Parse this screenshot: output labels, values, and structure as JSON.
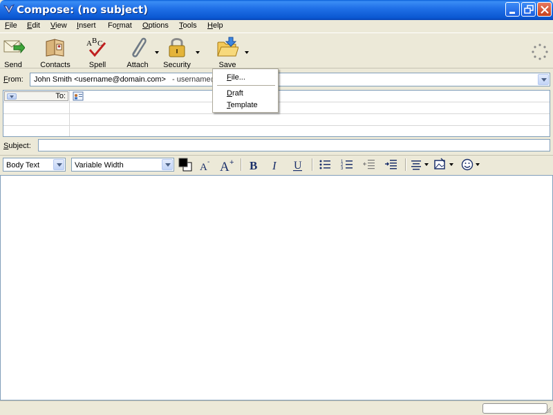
{
  "window": {
    "title": "Compose: (no subject)"
  },
  "menu": [
    {
      "acc": "F",
      "rest": "ile"
    },
    {
      "acc": "E",
      "rest": "dit"
    },
    {
      "acc": "V",
      "rest": "iew"
    },
    {
      "acc": "I",
      "rest": "nsert"
    },
    {
      "pre": "Fo",
      "acc": "r",
      "rest": "mat"
    },
    {
      "acc": "O",
      "rest": "ptions"
    },
    {
      "acc": "T",
      "rest": "ools"
    },
    {
      "acc": "H",
      "rest": "elp"
    }
  ],
  "toolbar": {
    "send": "Send",
    "contacts": "Contacts",
    "spell": "Spell",
    "attach": "Attach",
    "security": "Security",
    "save": "Save"
  },
  "address": {
    "from_label": "From:",
    "from_value": "John Smith <username@domain.com>",
    "from_account": "- username@",
    "to_label": "To:",
    "subject_label": "Subject:",
    "subject_value": ""
  },
  "format": {
    "paragraph": "Body Text",
    "font": "Variable Width",
    "text_color": "#000000"
  },
  "save_menu": {
    "file": {
      "acc": "F",
      "rest": "ile..."
    },
    "draft": {
      "acc": "D",
      "rest": "raft"
    },
    "template": {
      "acc": "T",
      "rest": "emplate"
    }
  },
  "colors": {
    "titlebar": "#0b58d2",
    "chrome": "#ece9d8",
    "field_border": "#7f9db9"
  }
}
